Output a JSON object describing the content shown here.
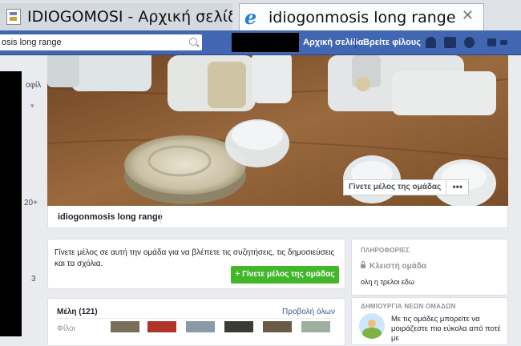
{
  "browser": {
    "tabs": [
      {
        "title": "IDIOGOMOSI - Αρχική σελίδα"
      },
      {
        "title": "idiogonmosis long range",
        "close": "✕"
      }
    ]
  },
  "topbar": {
    "search_value": "osis long range",
    "nav": {
      "home": "Αρχική σελίδα",
      "find_friends": "Βρείτε φίλους"
    }
  },
  "left": {
    "item1": "οφίλ",
    "arrow": "▾",
    "count1": "20+",
    "count2": "3"
  },
  "group": {
    "name": "idiogonmosis long range",
    "join_label": "Γίνετε μέλος της ομάδας",
    "more_label": "•••"
  },
  "join_card": {
    "text": "Γίνετε μέλος σε αυτή την ομάδα για να βλέπετε τις συζητήσεις, τις δημοσιεύσεις και τα σχόλια.",
    "button_plus": "+",
    "button": "Γίνετε μέλος της ομάδας"
  },
  "members": {
    "title": "Μέλη (121)",
    "view_all": "Προβολή όλων",
    "friends": "Φίλοι"
  },
  "info": {
    "heading": "ΠΛΗΡΟΦΟΡΙΕΣ",
    "privacy": "Κλειστή ομάδα",
    "description": "ολη η τρελοι εδω",
    "create_heading": "ΔΗΜΙΟΥΡΓΙΑ ΝΕΩΝ ΟΜΑΔΩΝ",
    "create_text": "Με τις ομάδες μπορείτε να μοιράζεστε πιο εύκολα από ποτέ με"
  }
}
